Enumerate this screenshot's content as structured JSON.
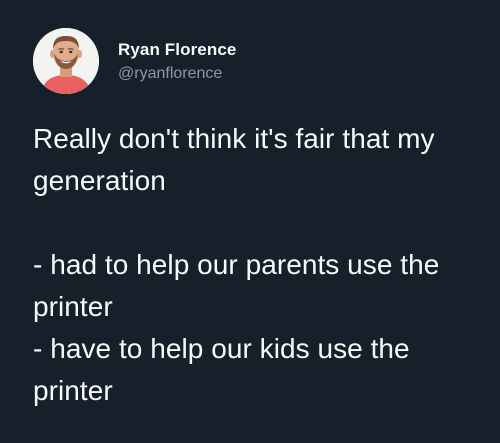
{
  "tweet": {
    "author": {
      "display_name": "Ryan Florence",
      "handle": "@ryanflorence",
      "avatar_icon": "user-avatar-photo"
    },
    "text": "Really don't think it's fair that my generation\n\n- had to help our parents use the printer\n- have to help our kids use the printer"
  },
  "colors": {
    "background": "#15202b",
    "text_primary": "#f7f9f9",
    "text_secondary": "#8b98a5"
  }
}
